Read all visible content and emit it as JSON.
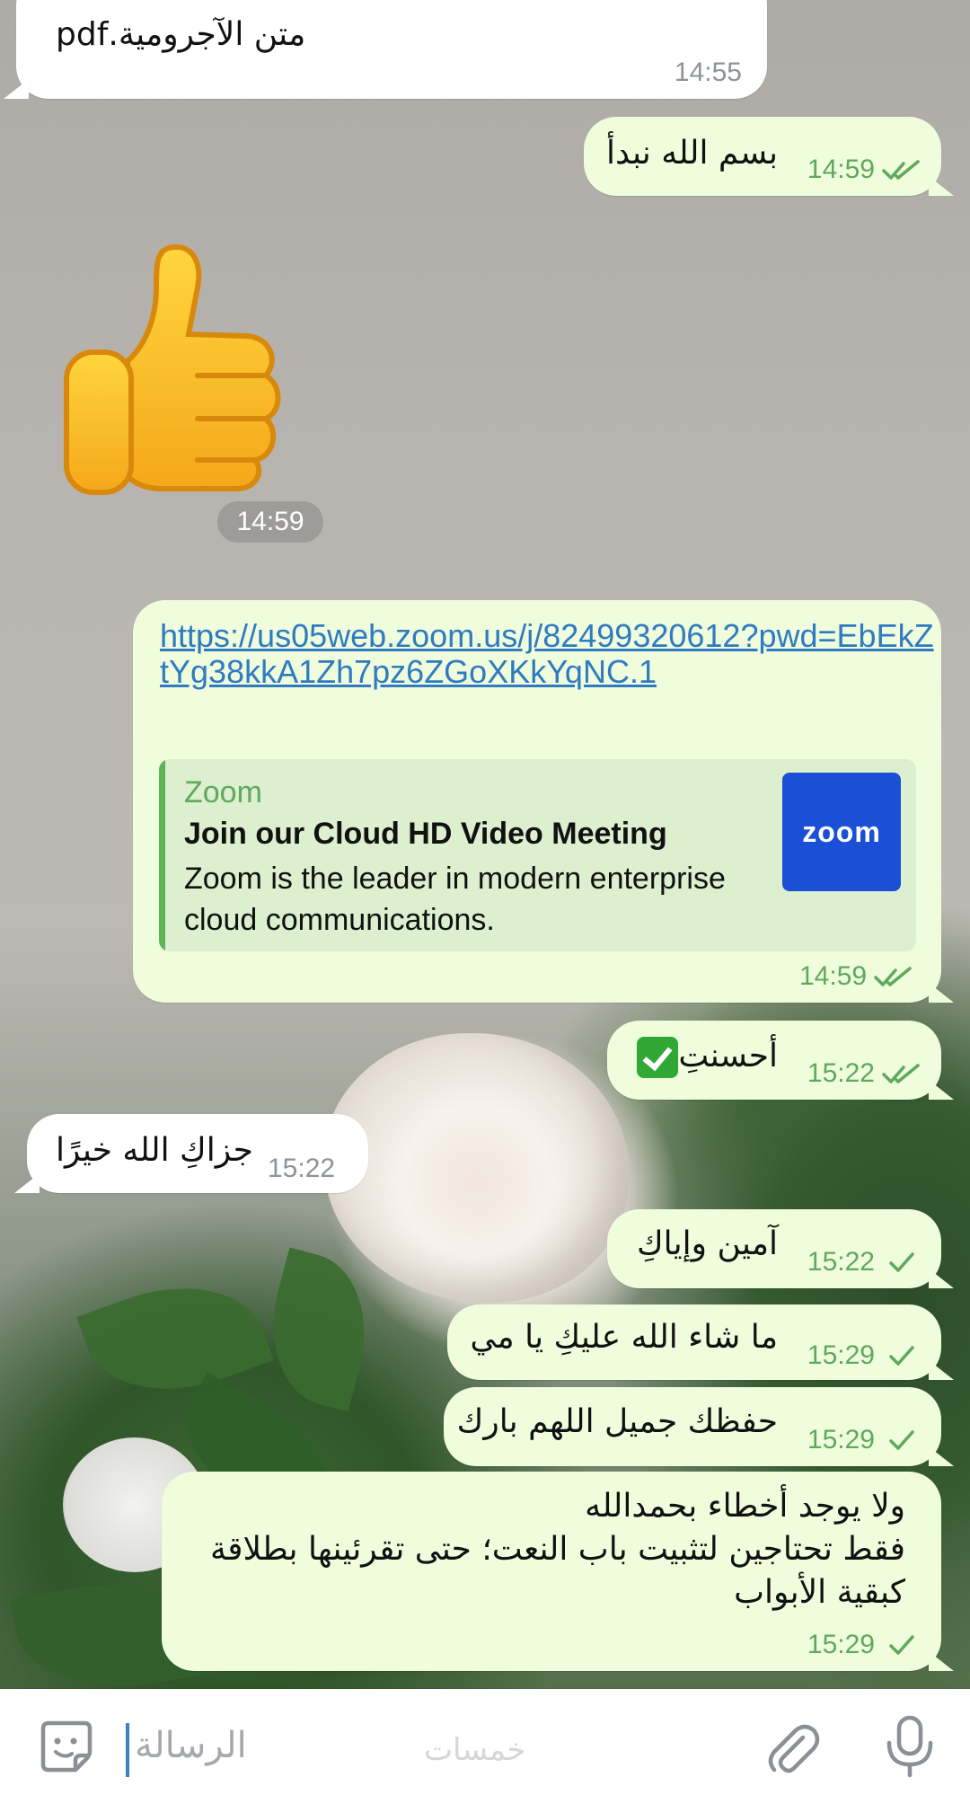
{
  "messages": [
    {
      "id": "m0",
      "direction": "in",
      "text": "متن الآجرومية.pdf",
      "time": "14:55"
    },
    {
      "id": "m1",
      "direction": "out",
      "text": "بسم الله نبدأ",
      "time": "14:59",
      "status": "read"
    },
    {
      "id": "m2",
      "direction": "in",
      "type": "sticker",
      "sticker": "thumbs-up",
      "time": "14:59"
    },
    {
      "id": "m3",
      "direction": "out",
      "type": "link",
      "link": "https://us05web.zoom.us/j/82499320612?pwd=EbEkZtYg38kkA1Zh7pz6ZGoXKkYqNC.1",
      "preview": {
        "site": "Zoom",
        "title": "Join our Cloud HD Video Meeting",
        "description": "Zoom is the leader in modern enterprise cloud communications.",
        "logo_text": "zoom"
      },
      "time": "14:59",
      "status": "read"
    },
    {
      "id": "m4",
      "direction": "out",
      "text": "أحسنتِ",
      "emoji": "check-mark-button",
      "time": "15:22",
      "status": "read"
    },
    {
      "id": "m5",
      "direction": "in",
      "text": "جزاكِ الله خيرًا",
      "time": "15:22"
    },
    {
      "id": "m6",
      "direction": "out",
      "text": "آمين وإياكِ",
      "time": "15:22",
      "status": "sent"
    },
    {
      "id": "m7",
      "direction": "out",
      "text": "ما شاء الله عليكِ يا مي",
      "time": "15:29",
      "status": "sent"
    },
    {
      "id": "m8",
      "direction": "out",
      "text": "حفظك جميل اللهم بارك",
      "time": "15:29",
      "status": "sent"
    },
    {
      "id": "m9",
      "direction": "out",
      "lines": [
        "ولا يوجد أخطاء بحمدالله",
        "فقط تحتاجين لتثبيت باب النعت؛ حتى تقرئينها بطلاقة",
        "كبقية الأبواب"
      ],
      "time": "15:29",
      "status": "sent"
    }
  ],
  "input": {
    "placeholder": "الرسالة",
    "watermark": "خمسات"
  },
  "colors": {
    "outgoing_bubble": "#effddd",
    "incoming_bubble": "#ffffff",
    "time_out": "#5fa85c",
    "link": "#2f7ac1",
    "zoom_brand": "#1a4fd6"
  },
  "icons": [
    "double-check-icon",
    "single-check-icon",
    "sticker-emoji-icon",
    "paperclip-icon",
    "microphone-icon",
    "thumbs-up-sticker"
  ]
}
